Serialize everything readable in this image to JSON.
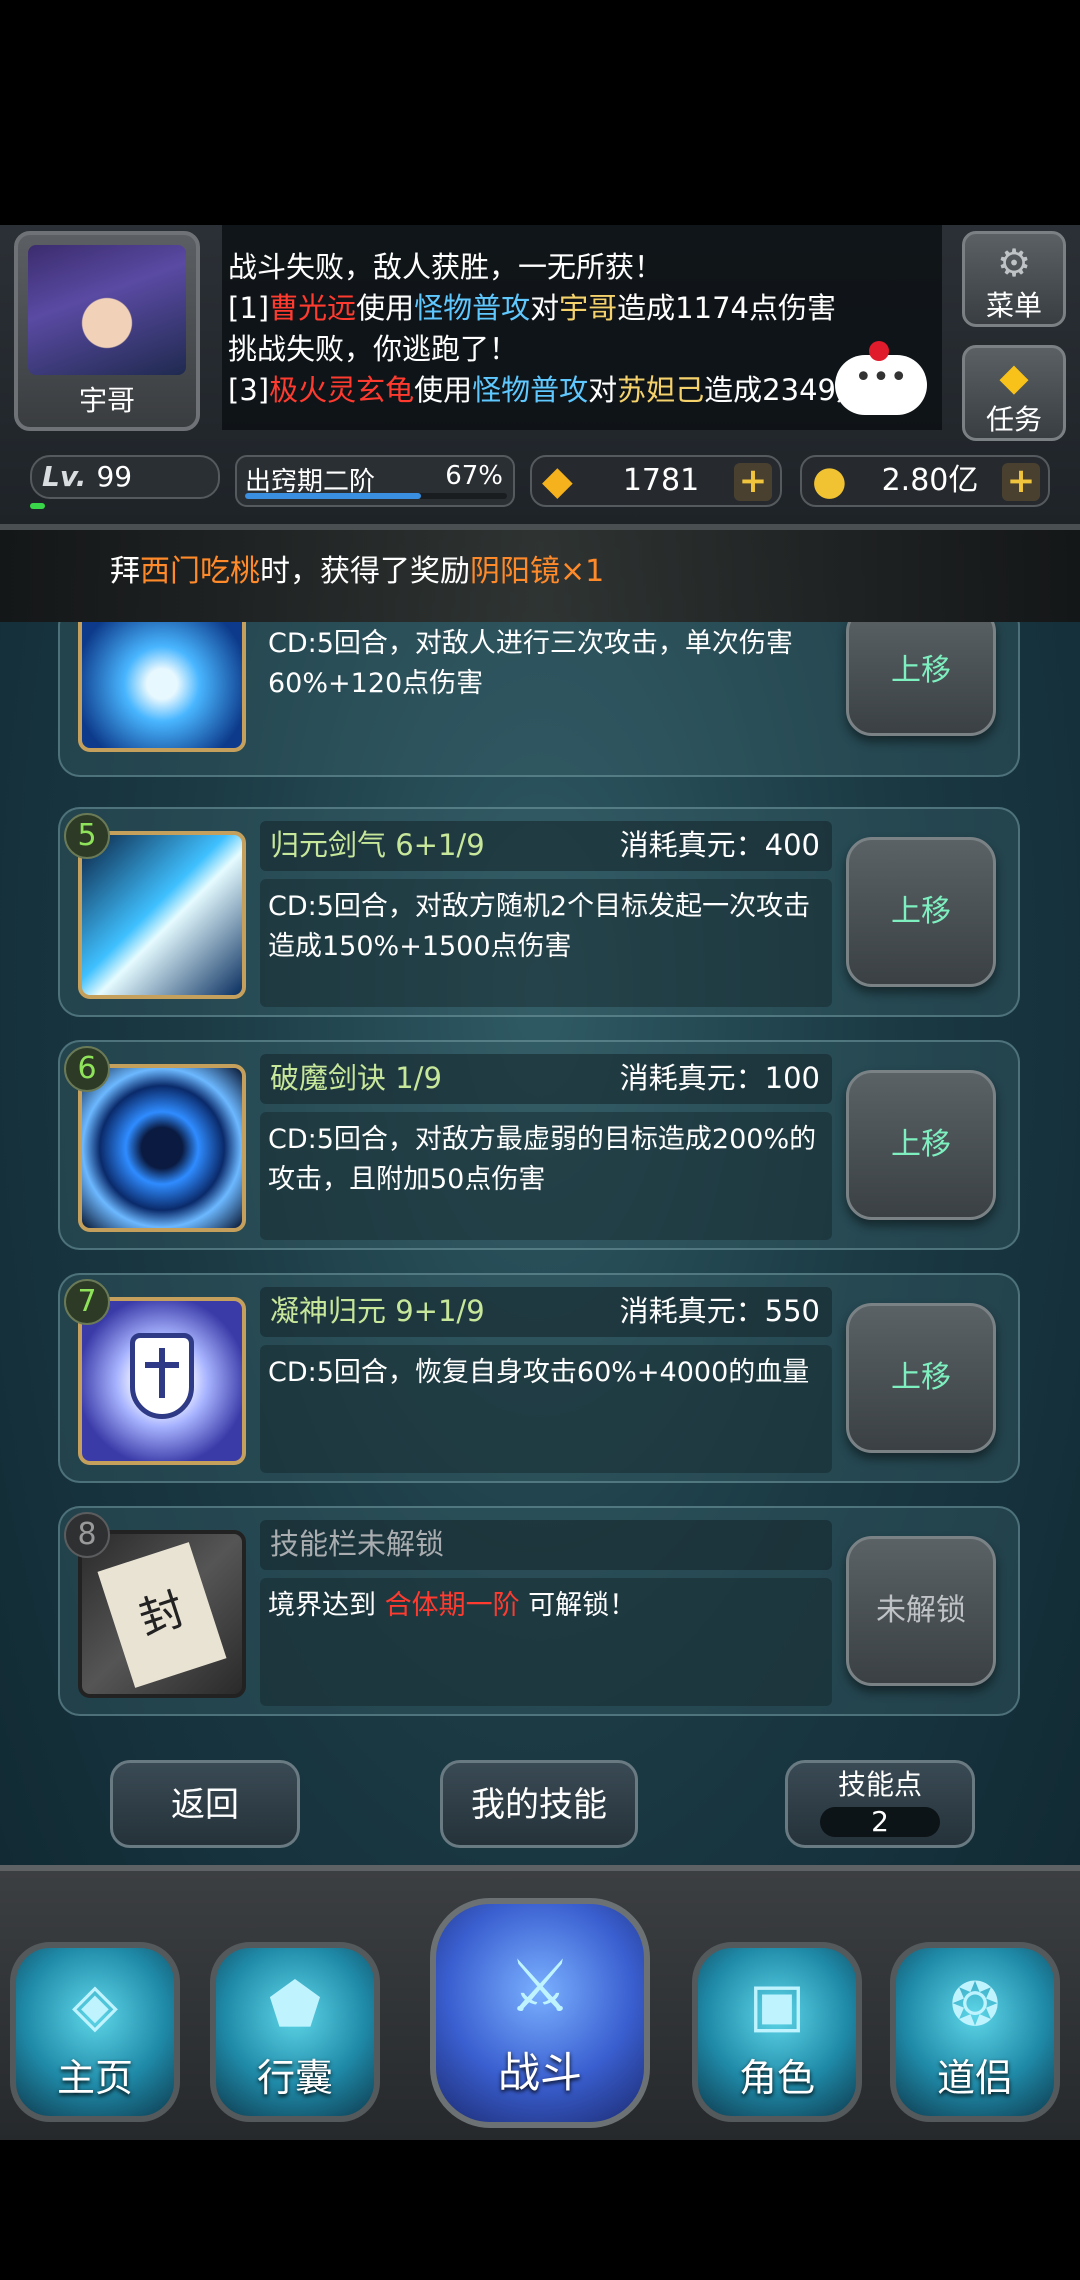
{
  "player": {
    "name": "宇哥",
    "level_label": "Lv.",
    "level": "99",
    "level_progress": 0.07
  },
  "realm": {
    "name": "出窍期二阶",
    "percent": "67%",
    "progress": 0.67
  },
  "currency": {
    "gems": "1781",
    "gold": "2.80亿",
    "plus": "+"
  },
  "side": {
    "menu_label": "菜单",
    "task_label": "任务"
  },
  "chat": {
    "bubble": "•••"
  },
  "log": {
    "line1": [
      "战斗失败，敌人获胜，一无所获！"
    ],
    "line2": [
      "[1]",
      "曹光远",
      "使用",
      "怪物普攻",
      "对",
      "宇哥",
      "造成1174点伤害"
    ],
    "line3": [
      "挑战失败，你逃跑了！"
    ],
    "line4": [
      "[3]",
      "极火灵玄龟",
      "使用",
      "怪物普攻",
      "对",
      "苏妲己",
      "造成2349点伤害"
    ]
  },
  "banner": [
    "拜",
    "西门吃桃",
    "时，获得了奖励",
    "阴阳镜×1"
  ],
  "skills": [
    {
      "desc": "CD:5回合，对敌人进行三次攻击，单次伤害60%+120点伤害",
      "button": "上移",
      "icon": "lightning-burst-icon"
    },
    {
      "num": "5",
      "name": "归元剑气 6+1/9",
      "cost": "消耗真元：400",
      "desc": "CD:5回合，对敌方随机2个目标发起一次攻击造成150%+1500点伤害",
      "button": "上移",
      "icon": "sword-aura-icon"
    },
    {
      "num": "6",
      "name": "破魔剑诀 1/9",
      "cost": "消耗真元：100",
      "desc": "CD:5回合，对敌方最虚弱的目标造成200%的攻击，且附加50点伤害",
      "button": "上移",
      "icon": "vortex-icon"
    },
    {
      "num": "7",
      "name": "凝神归元 9+1/9",
      "cost": "消耗真元：550",
      "desc": "CD:5回合，恢复自身攻击60%+4000的血量",
      "button": "上移",
      "icon": "shield-icon"
    },
    {
      "num": "8",
      "name": "技能栏未解锁",
      "desc_prefix": "境界达到 ",
      "desc_realm": "合体期一阶",
      "desc_suffix": " 可解锁！",
      "button": "未解锁",
      "icon": "sealed-scroll-icon",
      "seal_char": "封"
    }
  ],
  "actions": {
    "back": "返回",
    "my_skills": "我的技能",
    "skill_points_label": "技能点",
    "skill_points": "2"
  },
  "tabs": {
    "home": "主页",
    "bag": "行囊",
    "battle": "战斗",
    "role": "角色",
    "dao": "道侣"
  },
  "colors": {
    "accent_green": "#8fe35a",
    "move_text": "#7ef0c0",
    "name_red": "#ff3b30",
    "skill_blue": "#5ec8ff",
    "name_yellow": "#f5d26b",
    "reward_orange": "#ff8a2a"
  }
}
